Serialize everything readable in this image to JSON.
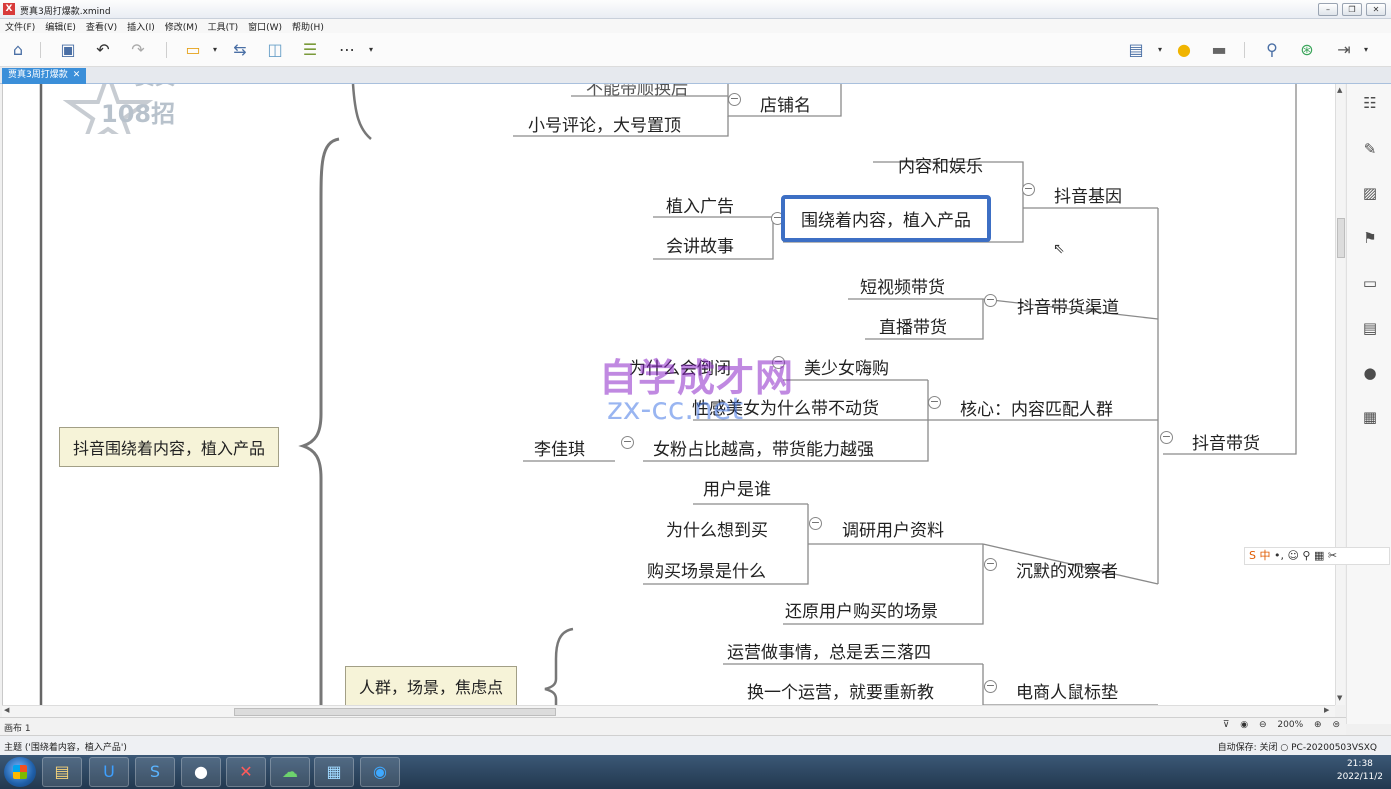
{
  "window": {
    "title": "贾真3周打爆款.xmind",
    "icon_text": "X",
    "controls": [
      "minimize",
      "restore",
      "close"
    ]
  },
  "menu": [
    "文件(F)",
    "编辑(E)",
    "查看(V)",
    "插入(I)",
    "修改(M)",
    "工具(T)",
    "窗口(W)",
    "帮助(H)"
  ],
  "toolbar": {
    "left_icons": [
      "home-icon",
      "save-icon",
      "undo-icon",
      "redo-icon",
      "topic-icon",
      "relationship-icon",
      "boundary-icon",
      "summary-icon",
      "more-icon"
    ],
    "right_icons": [
      "presentation-icon",
      "idea-icon",
      "outline-icon",
      "search-icon",
      "share-icon",
      "export-icon"
    ]
  },
  "tab": {
    "label": "贾真3周打爆款",
    "close": "✕"
  },
  "logo": {
    "text_top": "贾真",
    "text_bottom": "108招"
  },
  "mindmap": {
    "topics": {
      "cut_top": "不能带顺换后",
      "shop_name": "店铺名",
      "small_comment": "小号评论，大号置顶",
      "content_entertain": "内容和娱乐",
      "douyin_gene": "抖音基因",
      "implant_ad": "植入广告",
      "selected": "围绕着内容，植入产品",
      "storytelling": "会讲故事",
      "short_video": "短视频带货",
      "channels": "抖音带货渠道",
      "live": "直播带货",
      "why_fail": "为什么会倒闭",
      "beauty": "美少女嗨购",
      "sexy": "性感美女为什么带不动货",
      "core": "核心：内容匹配人群",
      "li_jiaqi": "李佳琪",
      "female_fans": "女粉占比越高，带货能力越强",
      "douyin_sales": "抖音带货",
      "main_box": "抖音围绕着内容，植入产品",
      "who": "用户是谁",
      "why_buy": "为什么想到买",
      "research": "调研用户资料",
      "scene": "购买场景是什么",
      "observer": "沉默的观察者",
      "restore_scene": "还原用户购买的场景",
      "ops_mess": "运营做事情，总是丢三落四",
      "crowd_box": "人群，场景，焦虑点",
      "change_ops": "换一个运营，就要重新教",
      "mousepad": "电商人鼠标垫"
    }
  },
  "watermark": {
    "line1": "自学成才网",
    "line2": "zx-cc.net"
  },
  "sheet": {
    "tab": "画布 1",
    "zoom": "200%"
  },
  "status": {
    "left": "主题 ('围绕着内容，植入产品')",
    "autosave": "自动保存: 关闭",
    "pc": "PC-20200503VSXQ"
  },
  "ime": {
    "label": "中"
  },
  "taskbar": {
    "apps": [
      "explorer",
      "uu-booster",
      "sogou-browser",
      "qq",
      "xmind",
      "wechat",
      "notepad",
      "task-app"
    ],
    "time": "21:38",
    "date": "2022/11/2"
  }
}
